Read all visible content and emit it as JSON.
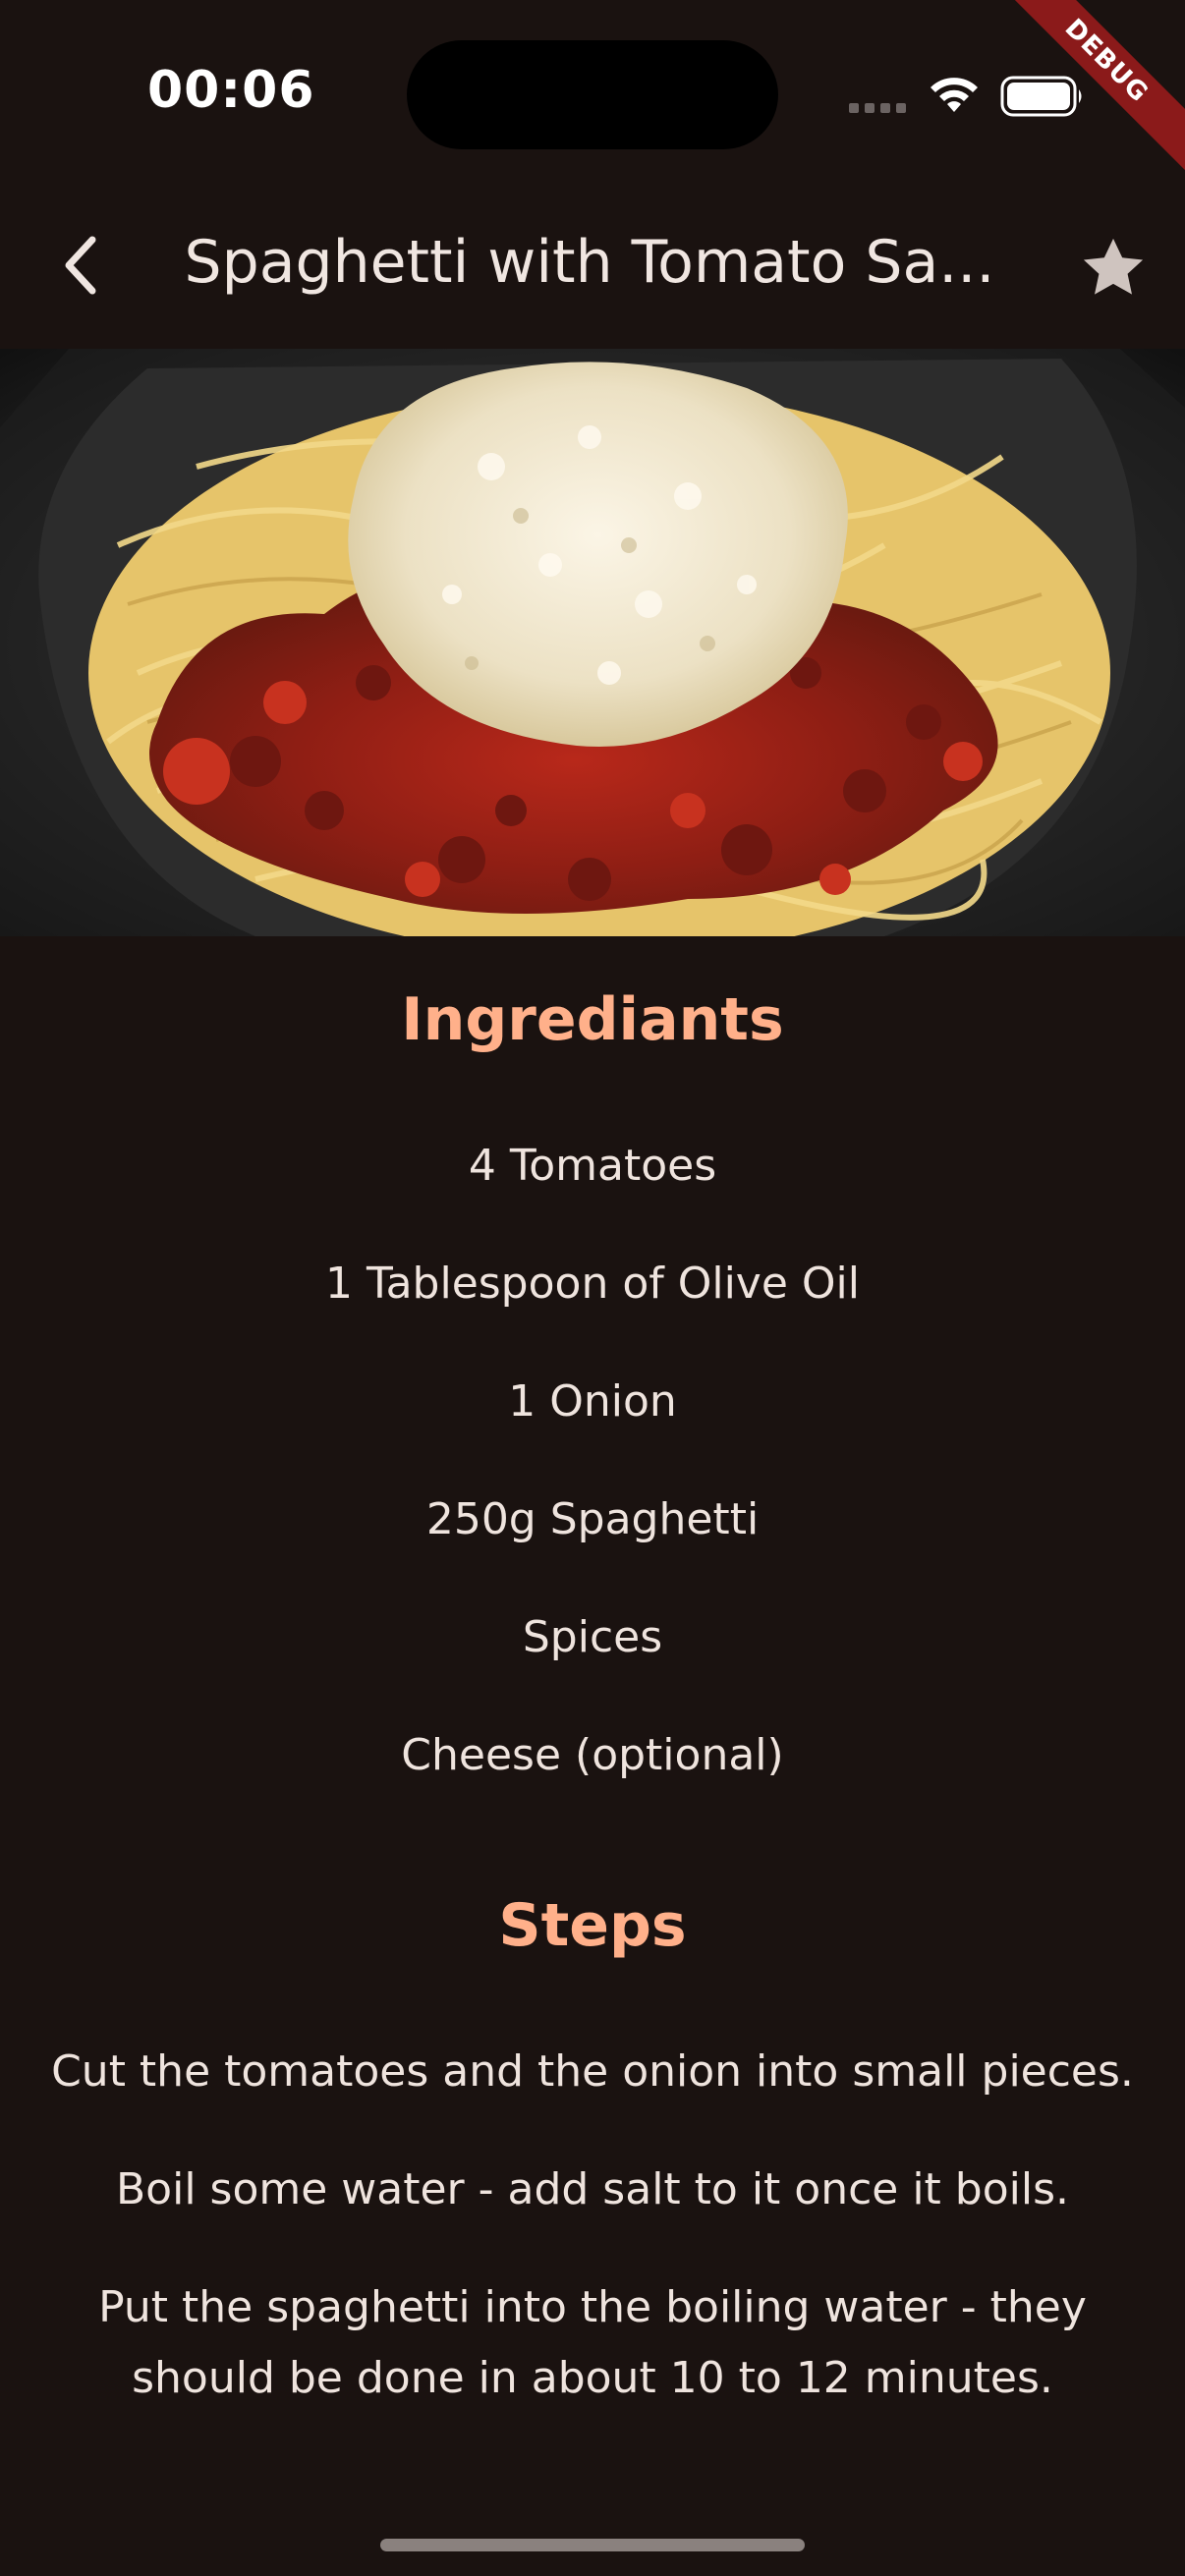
{
  "status_bar": {
    "time": "00:06",
    "debug_label": "DEBUG"
  },
  "app_bar": {
    "title": "Spaghetti with Tomato Sa...",
    "back_icon": "chevron-left-icon",
    "favorite_icon": "star-icon"
  },
  "ingredients": {
    "heading": "Ingrediants",
    "items": [
      "4 Tomatoes",
      "1 Tablespoon of Olive Oil",
      "1 Onion",
      "250g Spaghetti",
      "Spices",
      "Cheese (optional)"
    ]
  },
  "steps": {
    "heading": "Steps",
    "items": [
      "Cut the tomatoes and the onion into small pieces.",
      "Boil some water - add salt to it once it boils.",
      "Put the spaghetti into the boiling water - they should be done in about 10 to 12 minutes."
    ]
  },
  "colors": {
    "background": "#1a1210",
    "accent": "#ffb08a",
    "text": "#efe4de"
  }
}
